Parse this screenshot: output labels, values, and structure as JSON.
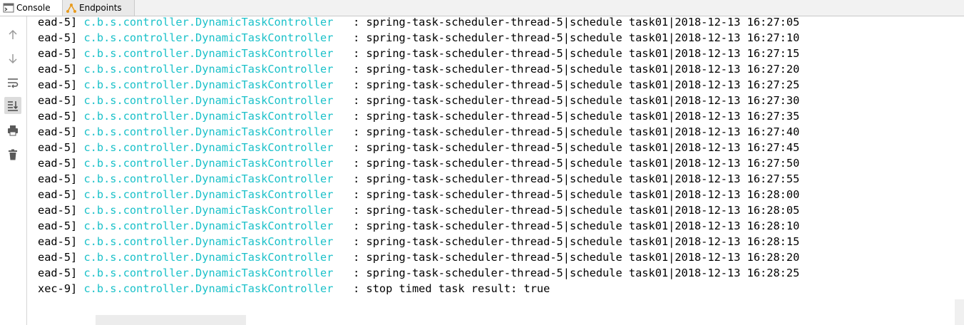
{
  "tabs": [
    {
      "label": "Console",
      "icon": "console-icon"
    },
    {
      "label": "Endpoints",
      "icon": "endpoints-icon"
    }
  ],
  "toolbar": [
    {
      "name": "scroll-up-icon"
    },
    {
      "name": "scroll-down-icon"
    },
    {
      "name": "soft-wrap-icon"
    },
    {
      "name": "scroll-to-end-icon",
      "active": true
    },
    {
      "name": "print-icon"
    },
    {
      "name": "clear-all-icon"
    }
  ],
  "colors": {
    "logger": "#1bc1c9",
    "text": "#000000",
    "tabbar_bg": "#f2f2f2"
  },
  "log": {
    "lines": [
      {
        "thread": "ead-5] ",
        "logger": "c.b.s.controller.DynamicTaskController",
        "message": "   : spring-task-scheduler-thread-5|schedule task01|2018-12-13 16:27:05"
      },
      {
        "thread": "ead-5] ",
        "logger": "c.b.s.controller.DynamicTaskController",
        "message": "   : spring-task-scheduler-thread-5|schedule task01|2018-12-13 16:27:10"
      },
      {
        "thread": "ead-5] ",
        "logger": "c.b.s.controller.DynamicTaskController",
        "message": "   : spring-task-scheduler-thread-5|schedule task01|2018-12-13 16:27:15"
      },
      {
        "thread": "ead-5] ",
        "logger": "c.b.s.controller.DynamicTaskController",
        "message": "   : spring-task-scheduler-thread-5|schedule task01|2018-12-13 16:27:20"
      },
      {
        "thread": "ead-5] ",
        "logger": "c.b.s.controller.DynamicTaskController",
        "message": "   : spring-task-scheduler-thread-5|schedule task01|2018-12-13 16:27:25"
      },
      {
        "thread": "ead-5] ",
        "logger": "c.b.s.controller.DynamicTaskController",
        "message": "   : spring-task-scheduler-thread-5|schedule task01|2018-12-13 16:27:30"
      },
      {
        "thread": "ead-5] ",
        "logger": "c.b.s.controller.DynamicTaskController",
        "message": "   : spring-task-scheduler-thread-5|schedule task01|2018-12-13 16:27:35"
      },
      {
        "thread": "ead-5] ",
        "logger": "c.b.s.controller.DynamicTaskController",
        "message": "   : spring-task-scheduler-thread-5|schedule task01|2018-12-13 16:27:40"
      },
      {
        "thread": "ead-5] ",
        "logger": "c.b.s.controller.DynamicTaskController",
        "message": "   : spring-task-scheduler-thread-5|schedule task01|2018-12-13 16:27:45"
      },
      {
        "thread": "ead-5] ",
        "logger": "c.b.s.controller.DynamicTaskController",
        "message": "   : spring-task-scheduler-thread-5|schedule task01|2018-12-13 16:27:50"
      },
      {
        "thread": "ead-5] ",
        "logger": "c.b.s.controller.DynamicTaskController",
        "message": "   : spring-task-scheduler-thread-5|schedule task01|2018-12-13 16:27:55"
      },
      {
        "thread": "ead-5] ",
        "logger": "c.b.s.controller.DynamicTaskController",
        "message": "   : spring-task-scheduler-thread-5|schedule task01|2018-12-13 16:28:00"
      },
      {
        "thread": "ead-5] ",
        "logger": "c.b.s.controller.DynamicTaskController",
        "message": "   : spring-task-scheduler-thread-5|schedule task01|2018-12-13 16:28:05"
      },
      {
        "thread": "ead-5] ",
        "logger": "c.b.s.controller.DynamicTaskController",
        "message": "   : spring-task-scheduler-thread-5|schedule task01|2018-12-13 16:28:10"
      },
      {
        "thread": "ead-5] ",
        "logger": "c.b.s.controller.DynamicTaskController",
        "message": "   : spring-task-scheduler-thread-5|schedule task01|2018-12-13 16:28:15"
      },
      {
        "thread": "ead-5] ",
        "logger": "c.b.s.controller.DynamicTaskController",
        "message": "   : spring-task-scheduler-thread-5|schedule task01|2018-12-13 16:28:20"
      },
      {
        "thread": "ead-5] ",
        "logger": "c.b.s.controller.DynamicTaskController",
        "message": "   : spring-task-scheduler-thread-5|schedule task01|2018-12-13 16:28:25"
      },
      {
        "thread": "xec-9] ",
        "logger": "c.b.s.controller.DynamicTaskController",
        "message": "   : stop timed task result: true"
      }
    ]
  }
}
